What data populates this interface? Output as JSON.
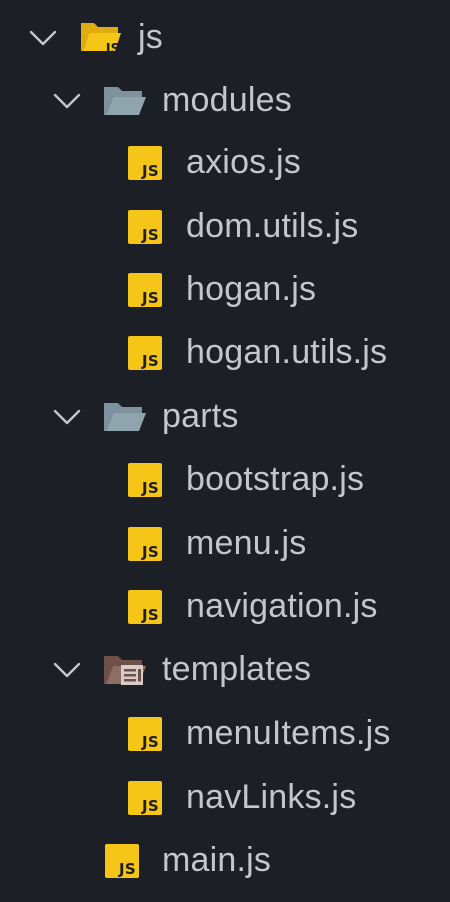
{
  "explorer": {
    "root": {
      "label": "js",
      "icon": "js-folder-open-icon",
      "expanded": true,
      "children": {
        "modules": {
          "label": "modules",
          "icon": "folder-open-icon",
          "expanded": true,
          "files": [
            {
              "label": "axios.js",
              "icon": "js-file-icon"
            },
            {
              "label": "dom.utils.js",
              "icon": "js-file-icon"
            },
            {
              "label": "hogan.js",
              "icon": "js-file-icon"
            },
            {
              "label": "hogan.utils.js",
              "icon": "js-file-icon"
            }
          ]
        },
        "parts": {
          "label": "parts",
          "icon": "folder-open-icon",
          "expanded": true,
          "files": [
            {
              "label": "bootstrap.js",
              "icon": "js-file-icon"
            },
            {
              "label": "menu.js",
              "icon": "js-file-icon"
            },
            {
              "label": "navigation.js",
              "icon": "js-file-icon"
            }
          ]
        },
        "templates": {
          "label": "templates",
          "icon": "templates-folder-open-icon",
          "expanded": true,
          "files": [
            {
              "label": "menuItems.js",
              "icon": "js-file-icon"
            },
            {
              "label": "navLinks.js",
              "icon": "js-file-icon"
            }
          ]
        },
        "main": {
          "label": "main.js",
          "icon": "js-file-icon"
        }
      }
    },
    "badge_text": "JS",
    "colors": {
      "background": "#1c1f25",
      "text": "#c3c7cd",
      "chevron": "#c3c7cd",
      "js_yellow": "#f5c518",
      "folder_blue_gray": "#90a4ae",
      "templates_brown": "#8d6e63"
    }
  }
}
